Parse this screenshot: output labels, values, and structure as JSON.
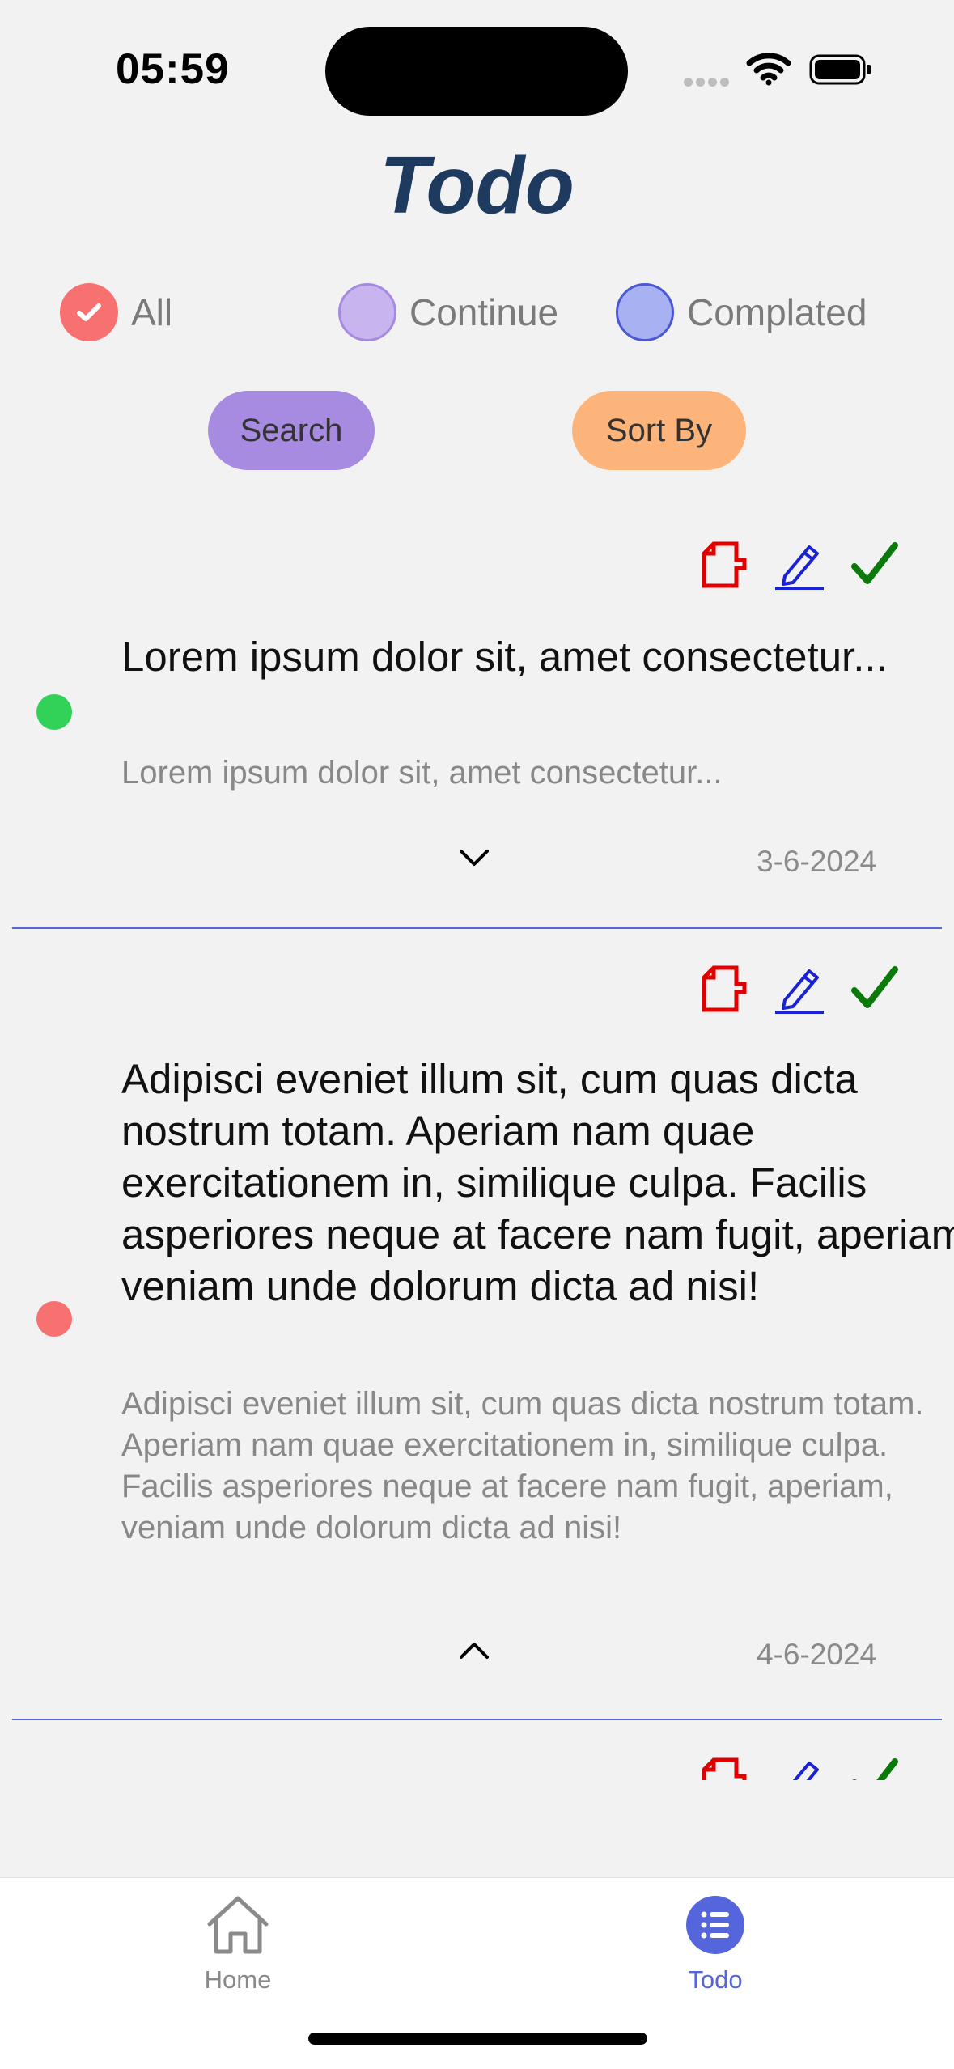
{
  "status_bar": {
    "time": "05:59"
  },
  "header": {
    "title": "Todo"
  },
  "filters": [
    {
      "label": "All",
      "selected": true
    },
    {
      "label": "Continue",
      "selected": false
    },
    {
      "label": "Complated",
      "selected": false
    }
  ],
  "buttons": {
    "search": "Search",
    "sort": "Sort By"
  },
  "todos": [
    {
      "title": "Lorem ipsum dolor sit, amet consectetur...",
      "description": "Lorem ipsum dolor sit, amet consectetur...",
      "date": "3-6-2024",
      "status_color": "#32d158",
      "expanded": false
    },
    {
      "title": "Adipisci eveniet illum sit, cum quas dicta nostrum totam. Aperiam nam quae exercitationem in, similique culpa. Facilis asperiores neque at facere nam fugit, aperiam, veniam unde dolorum dicta ad nisi!",
      "description": "Adipisci eveniet illum sit, cum quas dicta nostrum totam. Aperiam nam quae exercitationem in, similique culpa. Facilis asperiores neque at facere nam fugit, aperiam, veniam unde dolorum dicta ad nisi!",
      "date": "4-6-2024",
      "status_color": "#f87171",
      "expanded": true
    }
  ],
  "tabbar": {
    "home": {
      "label": "Home",
      "icon": "home-icon",
      "active": false
    },
    "todo": {
      "label": "Todo",
      "icon": "list-icon",
      "active": true
    }
  },
  "colors": {
    "accent": "#5566dd",
    "delete": "#e00000",
    "edit": "#1a22d6",
    "complete": "#0a7a0a"
  }
}
